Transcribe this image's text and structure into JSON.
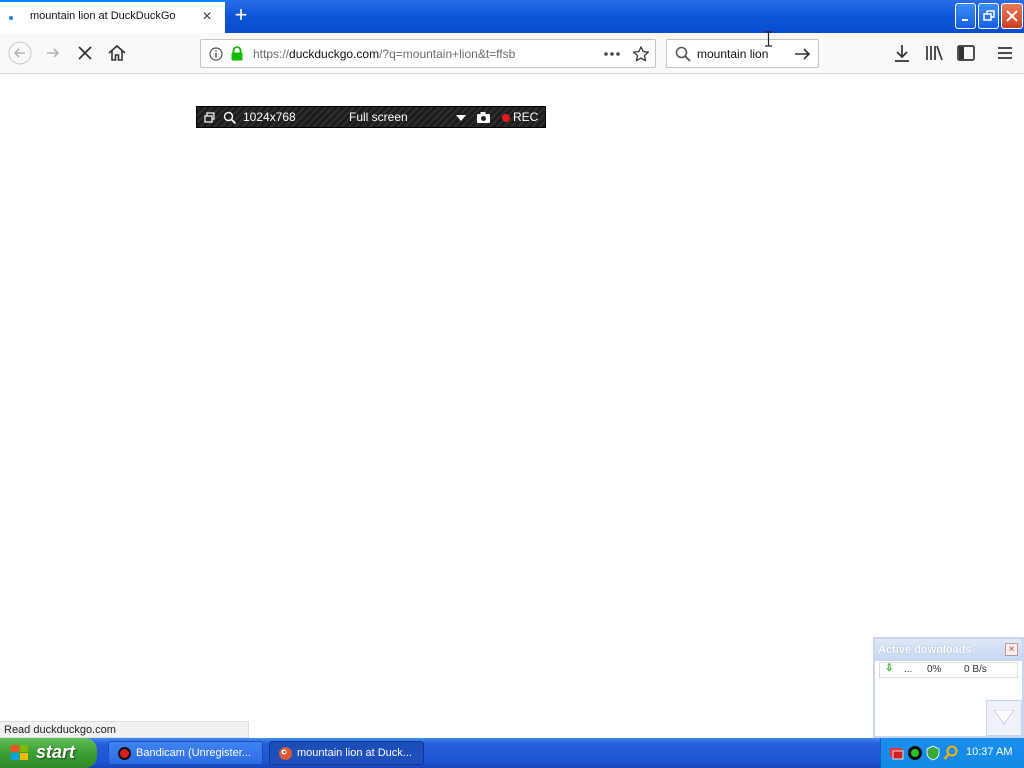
{
  "browser": {
    "tab_title": "mountain lion at DuckDuckGo",
    "url_prefix": "https://",
    "url_host": "duckduckgo.com",
    "url_rest": "/?q=mountain+lion&t=ffsb",
    "search_value": "mountain lion",
    "status_text": "Read duckduckgo.com"
  },
  "bandicam": {
    "resolution": "1024x768",
    "mode": "Full screen",
    "rec_label": "REC"
  },
  "downloads": {
    "title": "Active downloads",
    "item_name": "...",
    "item_progress": "0%",
    "item_speed": "0 B/s"
  },
  "taskbar": {
    "start_label": "start",
    "tasks": [
      {
        "label": "Bandicam (Unregister..."
      },
      {
        "label": "mountain lion at Duck..."
      }
    ],
    "clock": "10:37 AM"
  },
  "colors": {
    "accent": "#0a84ff",
    "secure_lock": "#12bc00",
    "rec_dot": "#e21b1b",
    "taskbar_blue": "#245edb",
    "start_green": "#3c9d35"
  }
}
